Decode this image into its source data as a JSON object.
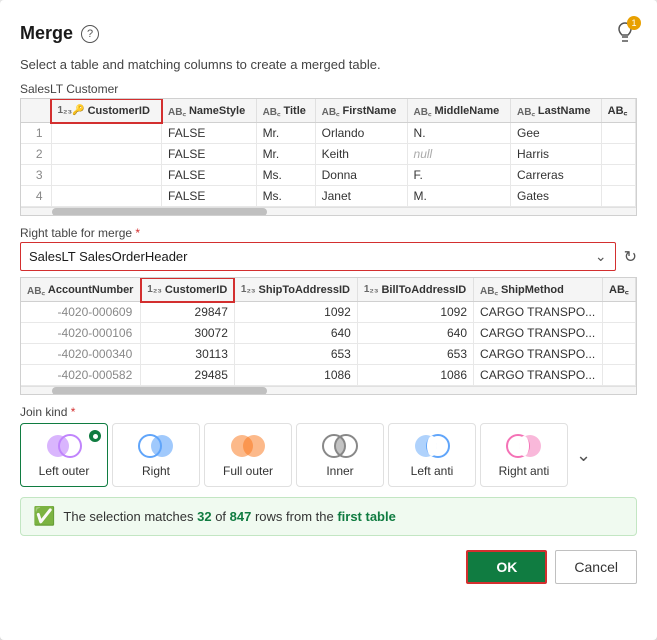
{
  "dialog": {
    "title": "Merge",
    "subtitle": "Select a table and matching columns to create a merged table.",
    "help_icon": "?",
    "notification_badge": "1"
  },
  "top_table": {
    "label": "SalesLT Customer",
    "columns": [
      {
        "type": "1₂₃🔑",
        "name": "CustomerID",
        "highlighted": true
      },
      {
        "type": "AB₃",
        "name": "NameStyle",
        "highlighted": false
      },
      {
        "type": "AB₃",
        "name": "Title",
        "highlighted": false
      },
      {
        "type": "AB₃",
        "name": "FirstName",
        "highlighted": false
      },
      {
        "type": "AB₃",
        "name": "MiddleName",
        "highlighted": false
      },
      {
        "type": "AB₃",
        "name": "LastName",
        "highlighted": false
      },
      {
        "type": "AB₃",
        "name": "...",
        "highlighted": false
      }
    ],
    "rows": [
      {
        "row_num": "1",
        "CustomerID": "",
        "NameStyle": "FALSE",
        "Title": "Mr.",
        "FirstName": "Orlando",
        "MiddleName": "N.",
        "LastName": "Gee"
      },
      {
        "row_num": "2",
        "CustomerID": "",
        "NameStyle": "FALSE",
        "Title": "Mr.",
        "FirstName": "Keith",
        "MiddleName": "null",
        "LastName": "Harris"
      },
      {
        "row_num": "3",
        "CustomerID": "",
        "NameStyle": "FALSE",
        "Title": "Ms.",
        "FirstName": "Donna",
        "MiddleName": "F.",
        "LastName": "Carreras"
      },
      {
        "row_num": "4",
        "CustomerID": "",
        "NameStyle": "FALSE",
        "Title": "Ms.",
        "FirstName": "Janet",
        "MiddleName": "M.",
        "LastName": "Gates"
      }
    ],
    "scroll_thumb_left": "20%",
    "scroll_thumb_width": "35%"
  },
  "right_table": {
    "label": "Right table for merge",
    "required": true,
    "selected": "SalesLT SalesOrderHeader",
    "columns": [
      {
        "type": "AB₃",
        "name": "AccountNumber",
        "highlighted": false
      },
      {
        "type": "1₂₃",
        "name": "CustomerID",
        "highlighted": true
      },
      {
        "type": "1₂₃",
        "name": "ShipToAddressID",
        "highlighted": false
      },
      {
        "type": "1₂₃",
        "name": "BillToAddressID",
        "highlighted": false
      },
      {
        "type": "AB₃",
        "name": "ShipMethod",
        "highlighted": false
      },
      {
        "type": "AB₃",
        "name": "...",
        "highlighted": false
      }
    ],
    "rows": [
      {
        "AccountNumber": "-4020-000609",
        "CustomerID": "29847",
        "ShipToAddressID": "1092",
        "BillToAddressID": "1092",
        "ShipMethod": "CARGO TRANSPO..."
      },
      {
        "AccountNumber": "-4020-000106",
        "CustomerID": "30072",
        "ShipToAddressID": "640",
        "BillToAddressID": "640",
        "ShipMethod": "CARGO TRANSPO..."
      },
      {
        "AccountNumber": "-4020-000340",
        "CustomerID": "30113",
        "ShipToAddressID": "653",
        "BillToAddressID": "653",
        "ShipMethod": "CARGO TRANSPO..."
      },
      {
        "AccountNumber": "-4020-000582",
        "CustomerID": "29485",
        "ShipToAddressID": "1086",
        "BillToAddressID": "1086",
        "ShipMethod": "CARGO TRANSPO..."
      }
    ]
  },
  "join_kind": {
    "label": "Join kind",
    "required": true,
    "options": [
      {
        "id": "left_outer",
        "label": "Left outer",
        "selected": true
      },
      {
        "id": "right",
        "label": "Right",
        "selected": false
      },
      {
        "id": "full_outer",
        "label": "Full outer",
        "selected": false
      },
      {
        "id": "inner",
        "label": "Inner",
        "selected": false
      },
      {
        "id": "left_anti",
        "label": "Left anti",
        "selected": false
      },
      {
        "id": "right_anti",
        "label": "Right anti",
        "selected": false
      }
    ]
  },
  "status": {
    "text_prefix": "The selection matches ",
    "match_count": "32",
    "text_middle": " of ",
    "total_count": "847",
    "text_suffix": " rows from the ",
    "table_ref": "first table"
  },
  "footer": {
    "ok_label": "OK",
    "cancel_label": "Cancel"
  }
}
